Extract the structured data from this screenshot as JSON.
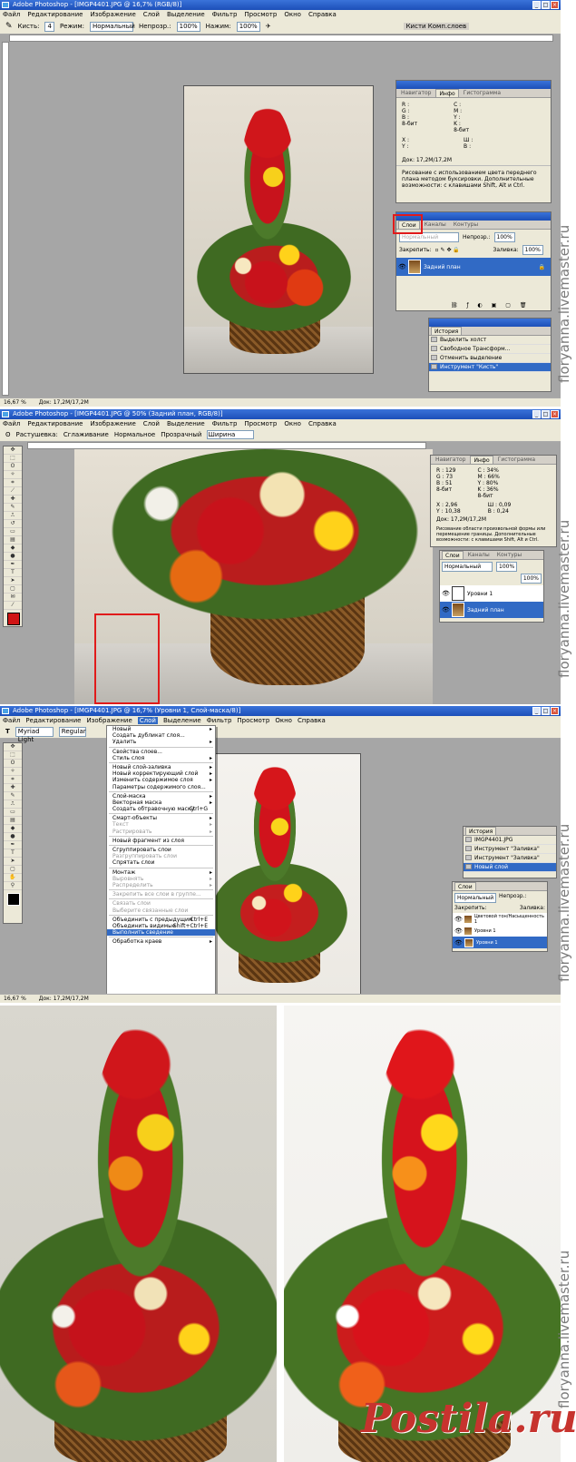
{
  "screen1": {
    "title": "Adobe Photoshop - [IMGP4401.JPG @ 16,7% (RGB/8)]",
    "menu": [
      "Файл",
      "Редактирование",
      "Изображение",
      "Слой",
      "Выделение",
      "Фильтр",
      "Просмотр",
      "Окно",
      "Справка"
    ],
    "options": {
      "brush_label": "Кисть:",
      "brush_size": "4",
      "mode_label": "Режим:",
      "mode_value": "Нормальный",
      "opacity_label": "Непрозр.:",
      "opacity_value": "100%",
      "flow_label": "Нажим:",
      "flow_value": "100%",
      "panel_well": "Кисти  Комп.слоев"
    },
    "info_panel": {
      "tabs": [
        "Навигатор",
        "Инфо",
        "Гистограмма"
      ],
      "labels_left": [
        "R :",
        "G :",
        "B :",
        "8-бит"
      ],
      "labels_right": [
        "C :",
        "M :",
        "Y :",
        "K :",
        "8-бит"
      ],
      "xy": [
        "X :",
        "Y :"
      ],
      "wh": [
        "Ш :",
        "В :"
      ],
      "doc": "Док: 17,2M/17,2M",
      "hint": "Рисование с использованием цвета переднего плана методом буксировки. Дополнительные возможности: с клавишами Shift, Alt и Ctrl."
    },
    "layers_panel": {
      "tabs": [
        "Слои",
        "Каналы",
        "Контуры"
      ],
      "blend": "Нормальный",
      "opacity_label": "Непрозр.:",
      "opacity_value": "100%",
      "lock_label": "Закрепить:",
      "fill_label": "Заливка:",
      "fill_value": "100%",
      "layer_name": "Задний план"
    },
    "history_panel": {
      "tab": "История",
      "items": [
        "Выделить холст",
        "Свободное Трансформ...",
        "Отменить выделение",
        "Инструмент \"Кисть\""
      ]
    },
    "status": {
      "zoom": "16,67 %",
      "doc": "Док: 17,2M/17,2M"
    }
  },
  "screen2": {
    "title": "Adobe Photoshop - [IMGP4401.JPG @ 50% (Задний план, RGB/8)]",
    "menu": [
      "Файл",
      "Редактирование",
      "Изображение",
      "Слой",
      "Выделение",
      "Фильтр",
      "Просмотр",
      "Окно",
      "Справка"
    ],
    "options": {
      "feather": "Растушевка:",
      "aa": "Сглаживание",
      "normal": "Нормальное",
      "modified": "Прозрачный",
      "width": "Ширина"
    },
    "info_panel": {
      "tabs": [
        "Навигатор",
        "Инфо",
        "Гистограмма"
      ],
      "vals_left": [
        "R : 129",
        "G : 73",
        "B : 51",
        "8-бит"
      ],
      "vals_right": [
        "C : 34%",
        "M : 66%",
        "Y : 80%",
        "K : 36%",
        "8-бит"
      ],
      "xy": [
        "X : 2,96",
        "Y : 10,38"
      ],
      "wh": [
        "Ш : 0,09",
        "В : 0,24"
      ],
      "doc": "Док: 17,2M/17,2M",
      "hint": "Рисование области произвольной формы или перемещение границы. Дополнительные возможности: с клавишами Shift, Alt и Ctrl."
    },
    "layers_panel": {
      "tabs": [
        "Слои",
        "Каналы",
        "Контуры"
      ],
      "blend": "Нормальный",
      "opacity_value": "100%",
      "fill_value": "100%",
      "layers": [
        "Уровни 1",
        "Задний план"
      ]
    }
  },
  "screen3": {
    "title": "Adobe Photoshop - [IMGP4401.JPG @ 16,7% (Уровни 1, Слой-маска/8)]",
    "menu": [
      "Файл",
      "Редактирование",
      "Изображение",
      "Слой",
      "Выделение",
      "Фильтр",
      "Просмотр",
      "Окно",
      "Справка"
    ],
    "active_menu": "Слой",
    "options": {
      "font": "Myriad Light",
      "style": "Regular"
    },
    "layer_menu": [
      {
        "t": "Новый",
        "arr": true
      },
      {
        "t": "Создать дубликат слоя..."
      },
      {
        "t": "Удалить",
        "arr": true
      },
      {
        "sep": true
      },
      {
        "t": "Свойства слоев..."
      },
      {
        "t": "Стиль слоя",
        "arr": true
      },
      {
        "sep": true
      },
      {
        "t": "Новый слой-заливка",
        "arr": true
      },
      {
        "t": "Новый корректирующий слой",
        "arr": true
      },
      {
        "t": "Изменить содержимое слоя",
        "arr": true
      },
      {
        "t": "Параметры содержимого слоя..."
      },
      {
        "sep": true
      },
      {
        "t": "Слой-маска",
        "arr": true
      },
      {
        "t": "Векторная маска",
        "arr": true
      },
      {
        "t": "Создать обтравочную маску",
        "sc": "Ctrl+G"
      },
      {
        "sep": true
      },
      {
        "t": "Смарт-объекты",
        "arr": true
      },
      {
        "t": "Текст",
        "arr": true,
        "dis": true
      },
      {
        "t": "Растрировать",
        "arr": true,
        "dis": true
      },
      {
        "sep": true
      },
      {
        "t": "Новый фрагмент из слоя"
      },
      {
        "sep": true
      },
      {
        "t": "Сгруппировать слои"
      },
      {
        "t": "Разгруппировать слои",
        "dis": true
      },
      {
        "t": "Спрятать слои"
      },
      {
        "sep": true
      },
      {
        "t": "Монтаж",
        "arr": true
      },
      {
        "t": "Выровнять",
        "arr": true,
        "dis": true
      },
      {
        "t": "Распределить",
        "arr": true,
        "dis": true
      },
      {
        "sep": true
      },
      {
        "t": "Закрепить все слои в группе...",
        "dis": true
      },
      {
        "sep": true
      },
      {
        "t": "Связать слои",
        "dis": true
      },
      {
        "t": "Выберите связанные слои",
        "dis": true
      },
      {
        "sep": true
      },
      {
        "t": "Объединить с предыдущим",
        "sc": "Ctrl+E"
      },
      {
        "t": "Объединить видимые",
        "sc": "Shift+Ctrl+E"
      },
      {
        "t": "Выполнить сведение",
        "sel": true
      },
      {
        "sep": true
      },
      {
        "t": "Обработка краев",
        "arr": true
      }
    ],
    "history_panel": {
      "tab": "История",
      "file": "IMGP4401.JPG",
      "items": [
        "Инструмент \"Заливка\"",
        "Инструмент \"Заливка\"",
        "Новый слой"
      ]
    },
    "layers_panel": {
      "tab": "Слои",
      "blend": "Нормальный",
      "opacity_label": "Непрозр.:",
      "fill_label": "Заливка:",
      "lock_label": "Закрепить:",
      "layers": [
        "Цветовой тон/Насыщенность 1",
        "Уровни 1",
        "Уровни 1"
      ]
    },
    "status": {
      "zoom": "16,67 %",
      "doc": "Док: 17,2M/17,2M"
    }
  },
  "watermark": [
    "floryanna.livemaster.ru",
    "floryanna.livemaster.ru",
    "floryanna.livemaster.ru",
    "floryanna.livemaster.ru"
  ],
  "footer_logo": "Postila.ru",
  "colors": {
    "xp_blue": "#316ac5",
    "panel": "#ece9d8",
    "canvas": "#a6a6a6",
    "highlight": "#e01b1b",
    "foreground": "#d01414"
  }
}
